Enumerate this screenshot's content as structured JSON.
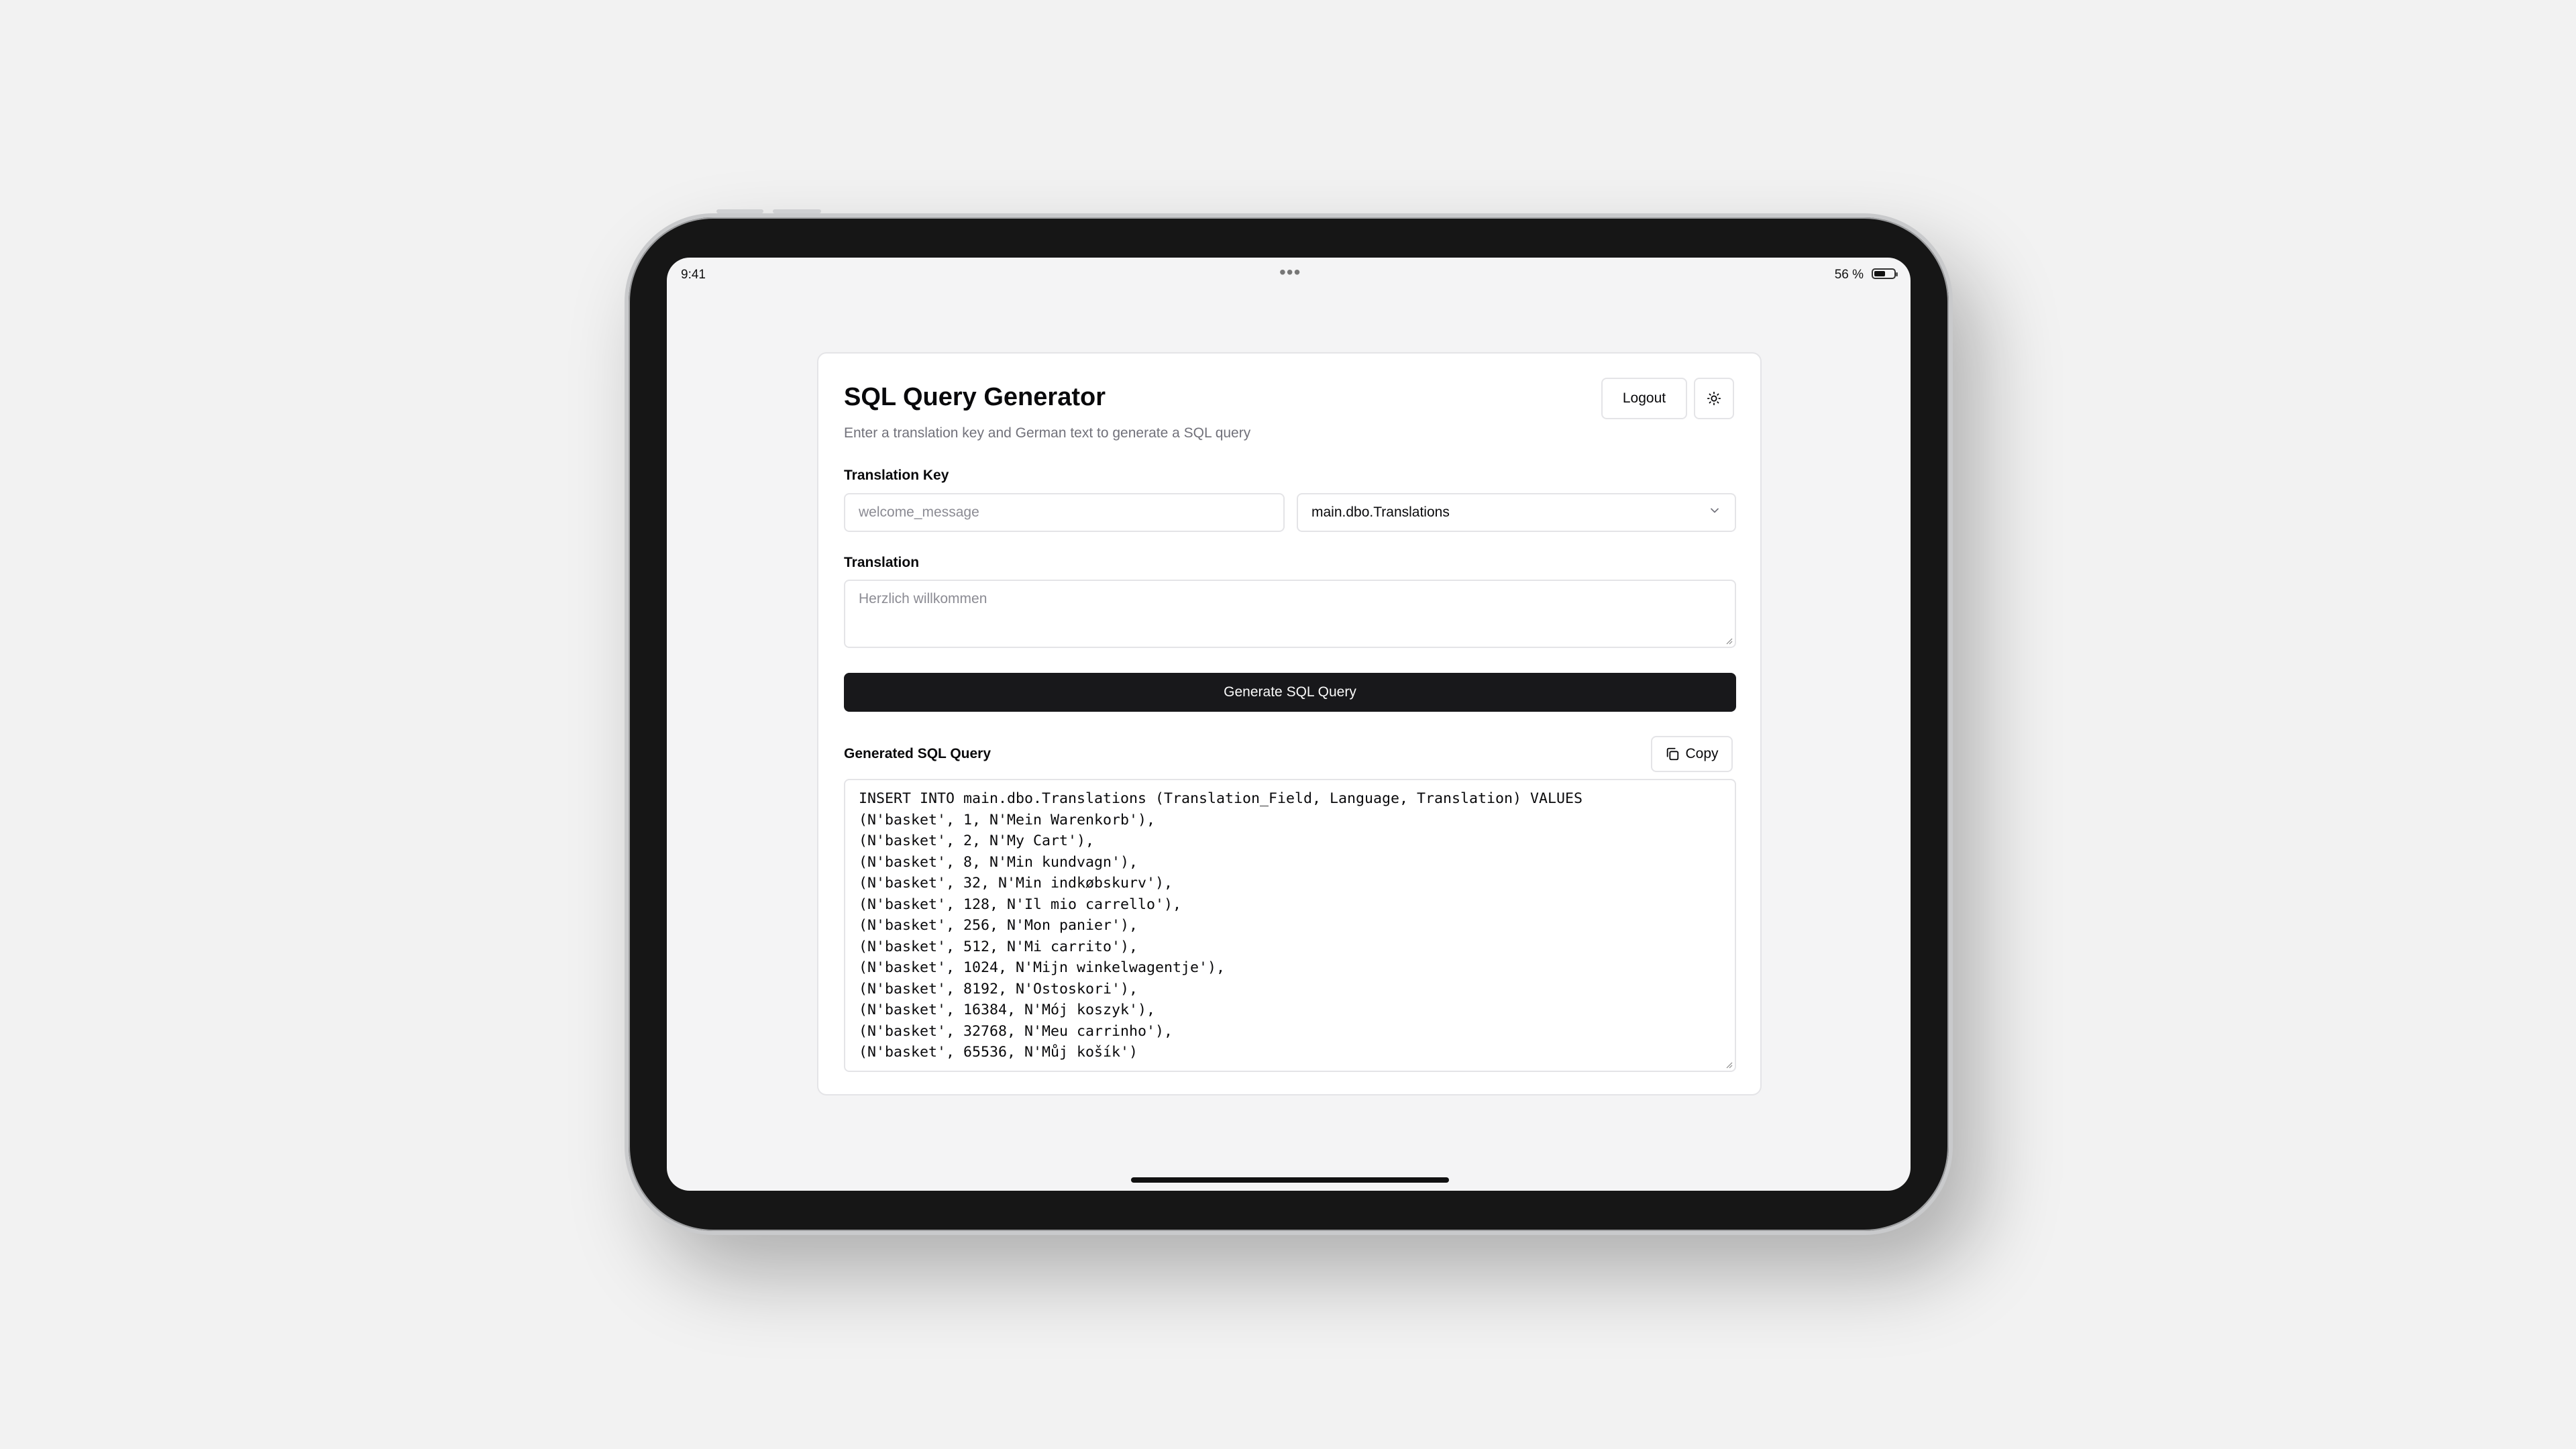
{
  "status_bar": {
    "time": "9:41",
    "multitask_dots": "•••",
    "battery_text": "56 %",
    "battery_level": 0.56
  },
  "header": {
    "title": "SQL Query Generator",
    "subtitle": "Enter a translation key and German text to generate a SQL query",
    "logout_label": "Logout",
    "theme_icon": "sun-icon"
  },
  "form": {
    "translation_key_label": "Translation Key",
    "translation_key_placeholder": "welcome_message",
    "table_selected": "main.dbo.Translations",
    "translation_label": "Translation",
    "translation_placeholder": "Herzlich willkommen",
    "generate_label": "Generate SQL Query"
  },
  "output": {
    "label": "Generated SQL Query",
    "copy_label": "Copy",
    "copy_icon": "copy-icon",
    "sql_lines": [
      "INSERT INTO main.dbo.Translations (Translation_Field, Language, Translation) VALUES",
      "(N'basket', 1, N'Mein Warenkorb'),",
      "(N'basket', 2, N'My Cart'),",
      "(N'basket', 8, N'Min kundvagn'),",
      "(N'basket', 32, N'Min indkøbskurv'),",
      "(N'basket', 128, N'Il mio carrello'),",
      "(N'basket', 256, N'Mon panier'),",
      "(N'basket', 512, N'Mi carrito'),",
      "(N'basket', 1024, N'Mijn winkelwagentje'),",
      "(N'basket', 8192, N'Ostoskori'),",
      "(N'basket', 16384, N'Mój koszyk'),",
      "(N'basket', 32768, N'Meu carrinho'),",
      "(N'basket', 65536, N'Můj košík')"
    ]
  }
}
